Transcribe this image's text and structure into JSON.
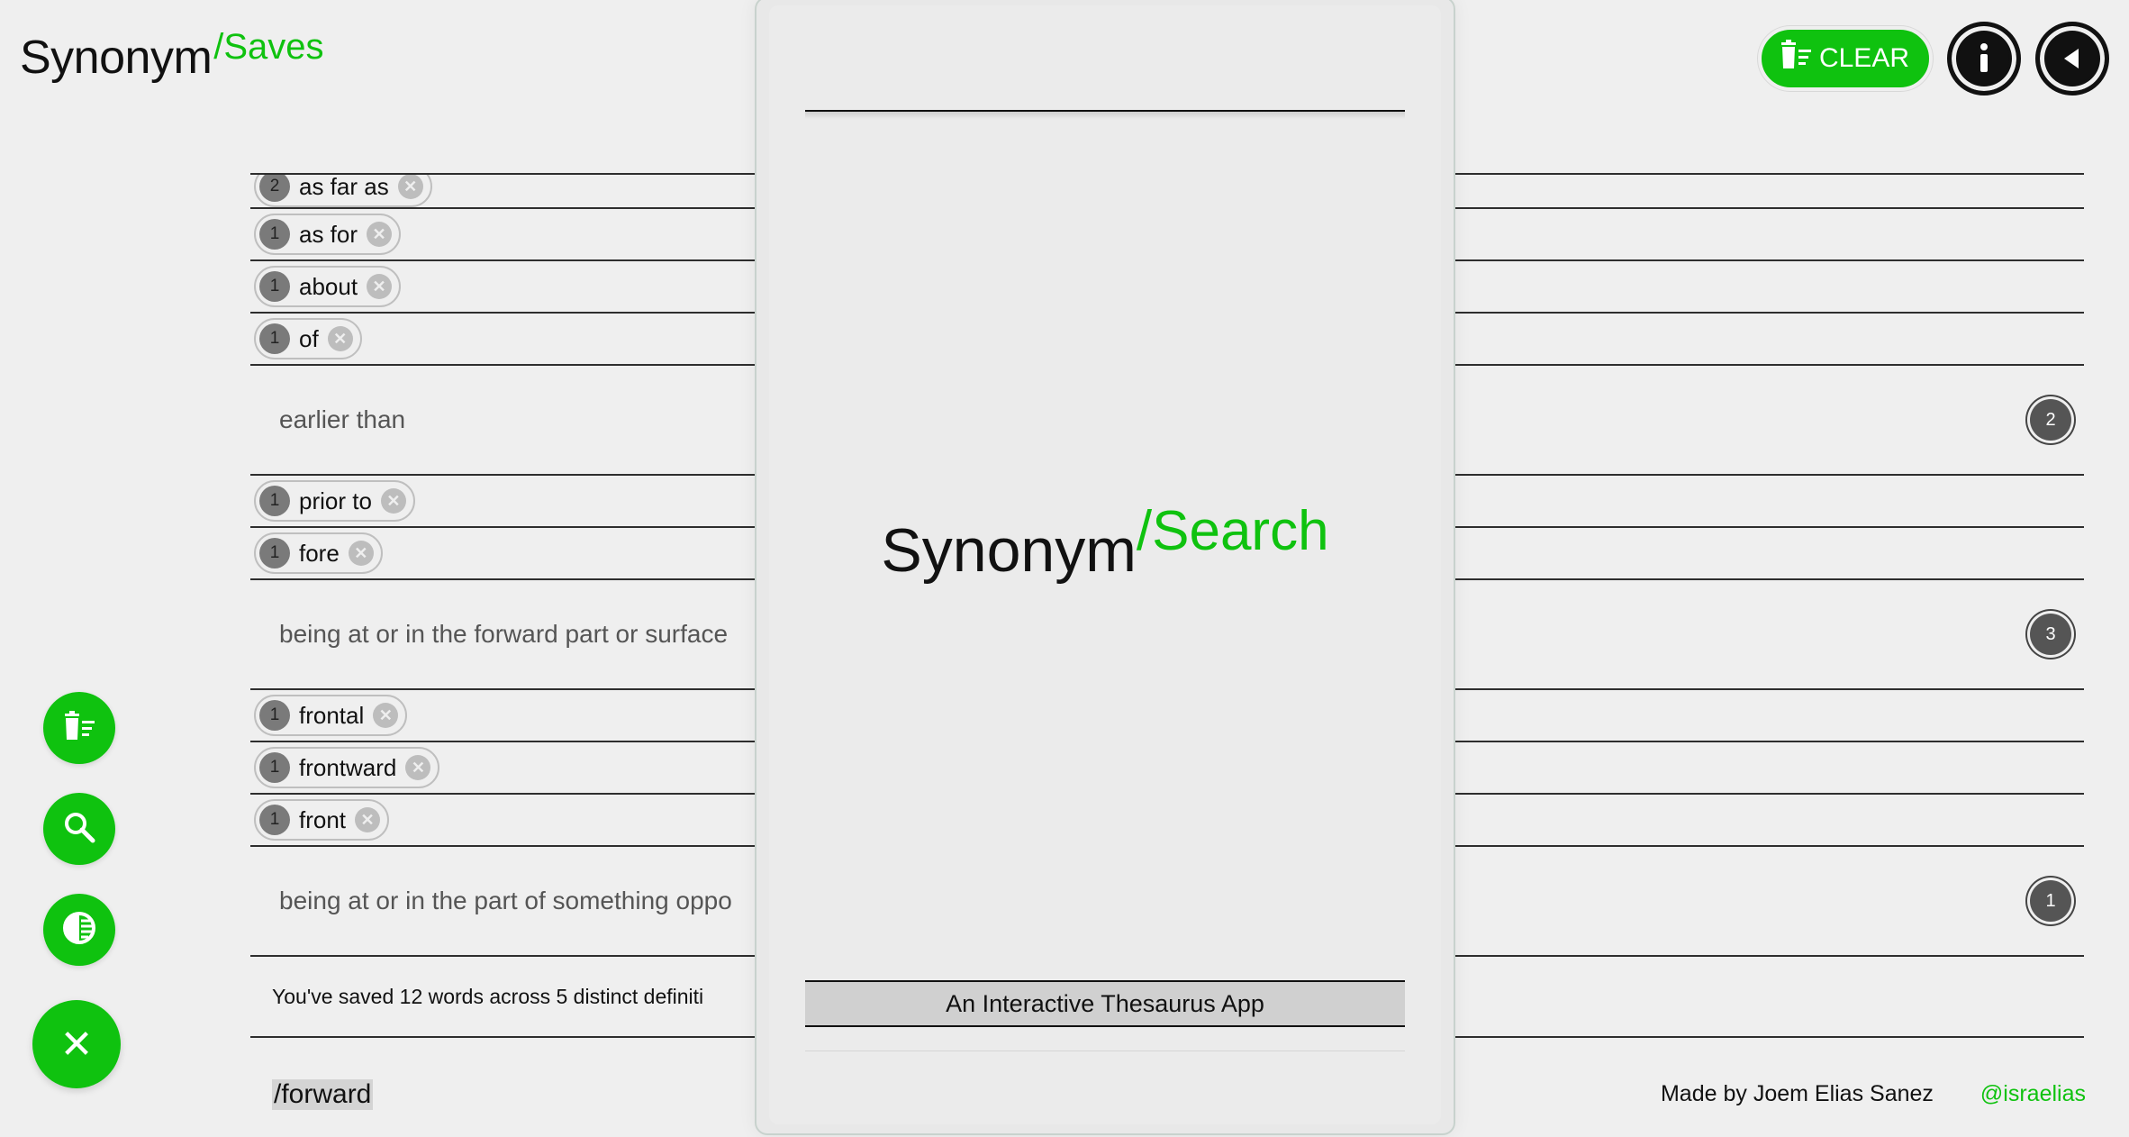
{
  "header": {
    "brand_main": "Synonym",
    "brand_sub": "/Saves",
    "clear_label": "CLEAR",
    "info_icon": "info-icon",
    "back_icon": "back-arrow-icon"
  },
  "side_buttons": {
    "clear_icon": "trash-list-icon",
    "search_icon": "search-icon",
    "theme_icon": "contrast-icon",
    "close_icon": "close-icon"
  },
  "list": {
    "g1_words": [
      {
        "count": "2",
        "word": "as far as"
      },
      {
        "count": "1",
        "word": "as for"
      },
      {
        "count": "1",
        "word": "about"
      },
      {
        "count": "1",
        "word": "of"
      }
    ],
    "g2_def": "earlier than",
    "g2_count": "2",
    "g2_words": [
      {
        "count": "1",
        "word": "prior to"
      },
      {
        "count": "1",
        "word": "fore"
      }
    ],
    "g3_def": "being at or in the forward part or surface",
    "g3_count": "3",
    "g3_words": [
      {
        "count": "1",
        "word": "frontal"
      },
      {
        "count": "1",
        "word": "frontward"
      },
      {
        "count": "1",
        "word": "front"
      }
    ],
    "g4_def": "being at or in the part of something oppo",
    "g4_count": "1",
    "summary": "You've saved 12 words across 5 distinct definiti"
  },
  "footer": {
    "query": "/forward",
    "credit_name": "Made by Joem Elias Sanez",
    "credit_handle": "@israelias"
  },
  "overlay": {
    "brand_main": "Synonym",
    "brand_sub": "/Search",
    "tagline": "An Interactive Thesaurus App"
  },
  "colors": {
    "accent": "#0fc20f",
    "background": "#efefef",
    "text": "#111111"
  }
}
